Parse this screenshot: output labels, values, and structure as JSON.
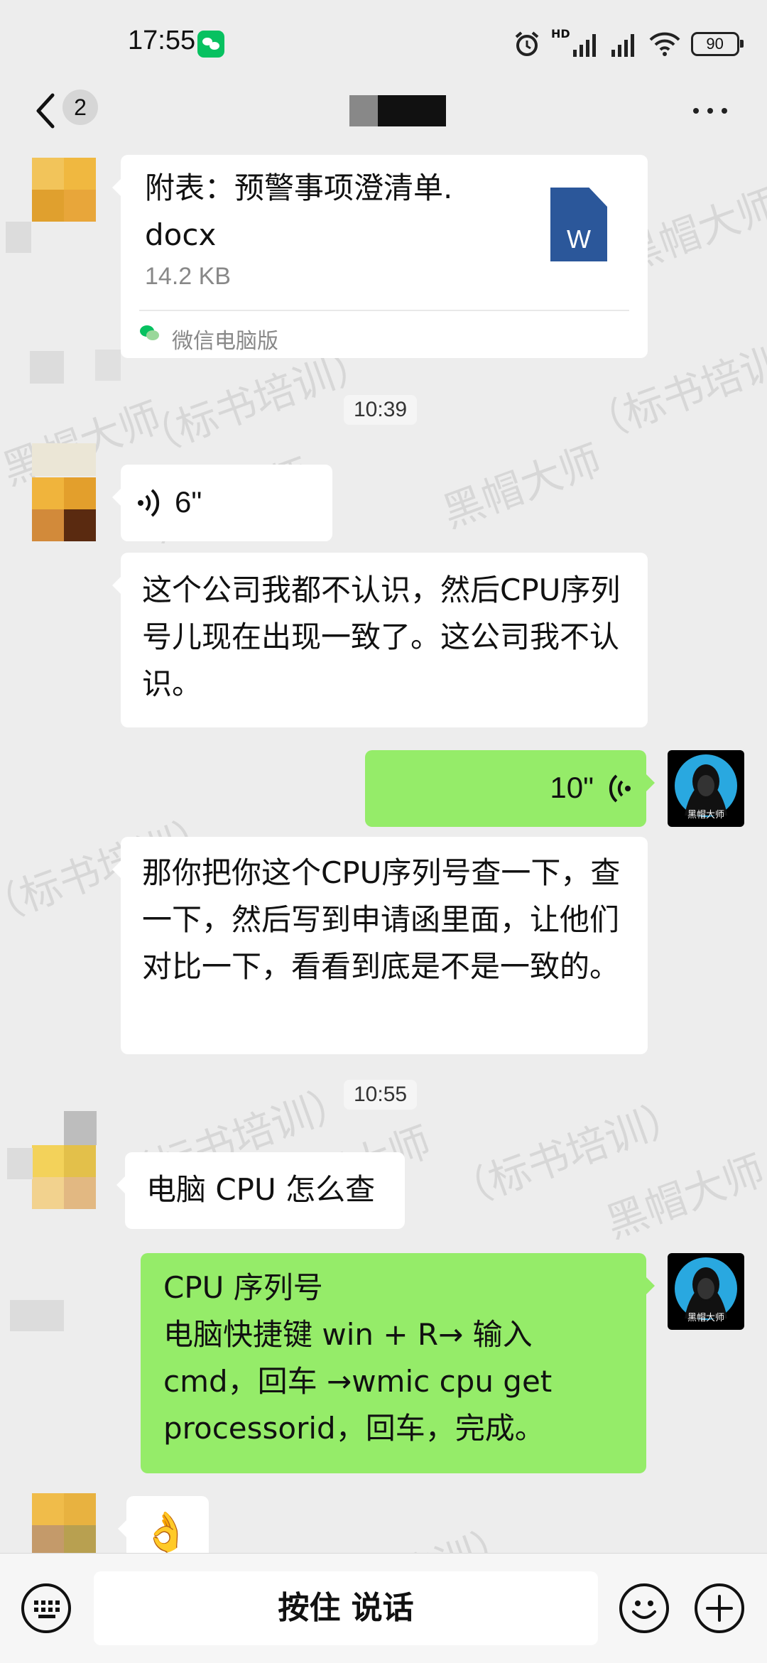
{
  "status_bar": {
    "time": "17:55",
    "net_label": "HD",
    "battery": "90"
  },
  "header": {
    "unread_count": "2"
  },
  "messages": {
    "file": {
      "name": "附表：预警事项澄清单.docx",
      "size": "14.2 KB",
      "source": "微信电脑版",
      "icon_letter": "W"
    },
    "time1": "10:39",
    "voice1": "6\"",
    "text1": "这个公司我都不认识，然后CPU序列号儿现在出现一致了。这公司我不认识。",
    "voice2": "10\"",
    "text2": "那你把你这个CPU序列号查一下，查一下，然后写到申请函里面，让他们对比一下，看看到底是不是一致的。",
    "time2": "10:55",
    "text3": "电脑 CPU 怎么查",
    "text4_line1": "CPU 序列号",
    "text4_line2": "电脑快捷键 win + R→ 输入 cmd，回车 →wmic cpu get processorid，回车，完成。",
    "emoji": "👌"
  },
  "avatar_label": "黑帽大师",
  "watermark_texts": [
    "黑帽大师",
    "（标书培训）"
  ],
  "input_bar": {
    "hold_to_talk": "按住 说话"
  },
  "colors": {
    "bubble_green": "#95ec69",
    "background": "#ededed",
    "wechat_green": "#07c160",
    "word_blue": "#2b579a"
  }
}
